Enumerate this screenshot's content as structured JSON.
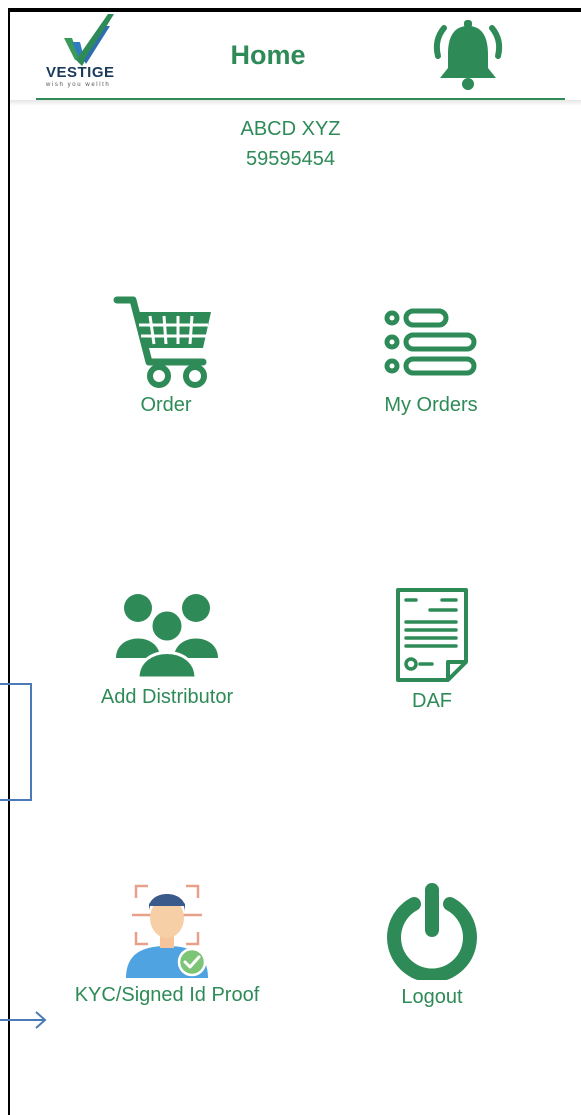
{
  "header": {
    "logo_text": "VESTIGE",
    "logo_tagline": "wish you wellth",
    "title": "Home"
  },
  "user": {
    "name": "ABCD XYZ",
    "id": "59595454"
  },
  "menu": [
    {
      "label": "Order",
      "icon": "cart-icon"
    },
    {
      "label": "My Orders",
      "icon": "list-icon"
    },
    {
      "label": "Add Distributor",
      "icon": "group-icon"
    },
    {
      "label": "DAF",
      "icon": "document-icon"
    },
    {
      "label": "KYC/Signed Id Proof",
      "icon": "id-verify-icon"
    },
    {
      "label": "Logout",
      "icon": "power-icon"
    }
  ],
  "colors": {
    "accent": "#2e8b57",
    "annotation": "#4a7bb7"
  }
}
